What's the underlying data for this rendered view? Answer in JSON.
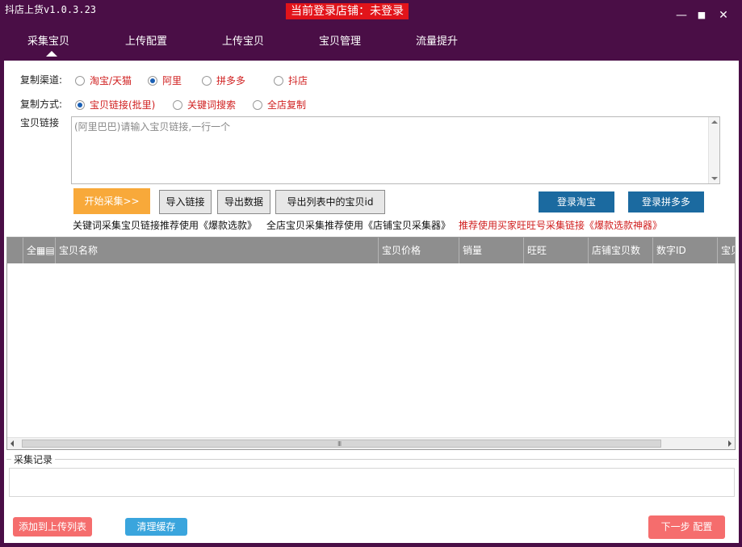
{
  "window": {
    "title": "抖店上货v1.0.3.23",
    "login_status": "当前登录店铺：未登录",
    "minimize": "—",
    "maximize": "■",
    "close": "✕"
  },
  "nav": {
    "tabs": [
      {
        "label": "采集宝贝",
        "active": true
      },
      {
        "label": "上传配置"
      },
      {
        "label": "上传宝贝"
      },
      {
        "label": "宝贝管理"
      },
      {
        "label": "流量提升"
      }
    ]
  },
  "form": {
    "channel_label": "复制渠道:",
    "channels": [
      {
        "label": "淘宝/天猫",
        "selected": false
      },
      {
        "label": "阿里",
        "selected": true
      },
      {
        "label": "拼多多",
        "selected": false
      },
      {
        "label": "抖店",
        "selected": false
      }
    ],
    "method_label": "复制方式:",
    "methods": [
      {
        "label": "宝贝链接(批里)",
        "selected": true
      },
      {
        "label": "关键词搜索",
        "selected": false
      },
      {
        "label": "全店复制",
        "selected": false
      }
    ],
    "link_label": "宝贝链接",
    "link_placeholder": "(阿里巴巴)请输入宝贝链接,一行一个"
  },
  "buttons": {
    "start": "开始采集>>",
    "import": "导入链接",
    "export": "导出数据",
    "export_ids": "导出列表中的宝贝id",
    "login_taobao": "登录淘宝",
    "login_pdd": "登录拼多多",
    "add_upload": "添加到上传列表",
    "clear_cache": "清理缓存",
    "next": "下一步 配置"
  },
  "tips": {
    "tip1": "关键词采集宝贝链接推荐使用《爆款选款》",
    "tip2": "全店宝贝采集推荐使用《店铺宝贝采集器》",
    "tip3": "推荐使用买家旺旺号采集链接《爆款选款神器》"
  },
  "table": {
    "columns": [
      "",
      "全▦▤",
      "宝贝名称",
      "宝贝价格",
      "销量",
      "旺旺",
      "店铺宝贝数",
      "数字ID",
      "宝贝"
    ],
    "rows": [],
    "scroll_grip": "III"
  },
  "log": {
    "title": "采集记录"
  },
  "colors": {
    "frame": "#4a0e46",
    "accent_red": "#d01f1f",
    "orange": "#f8a93a",
    "blue": "#1b6aa0"
  }
}
